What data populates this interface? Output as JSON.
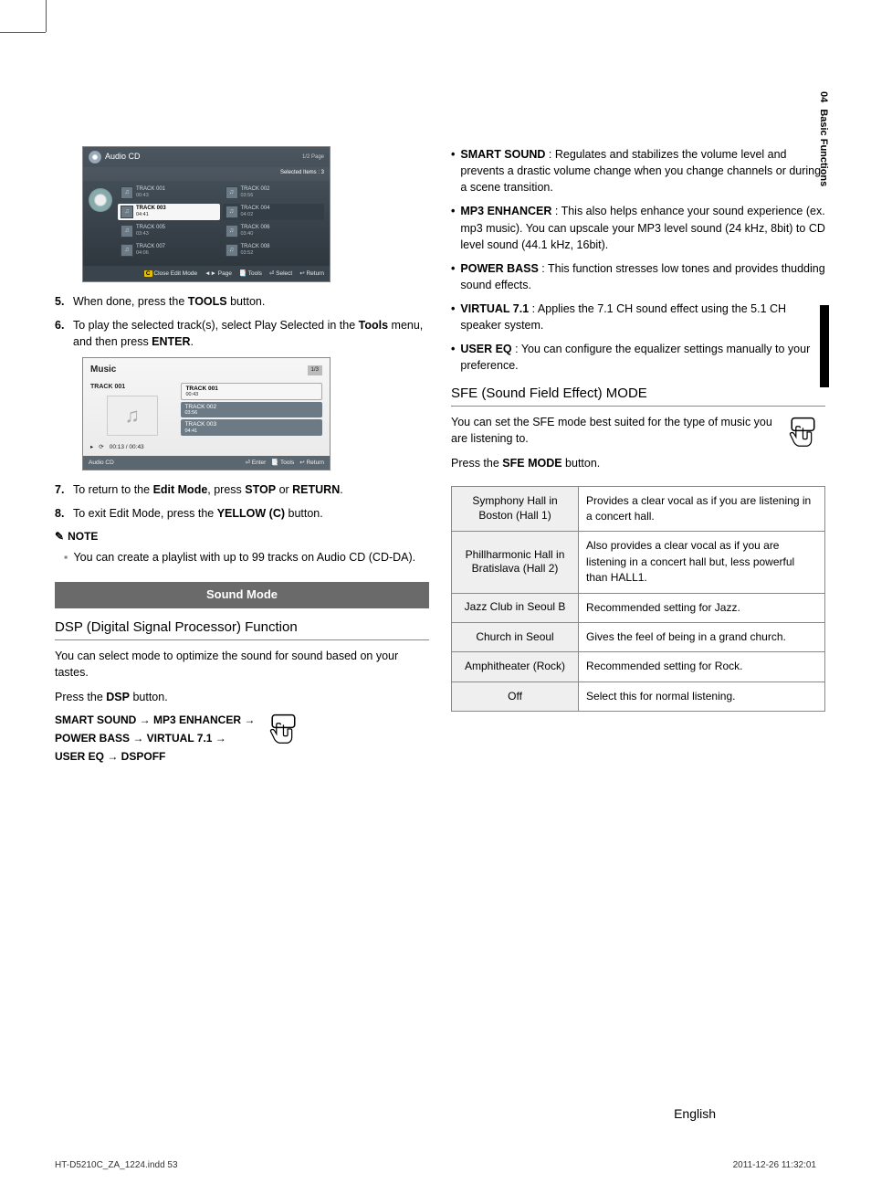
{
  "sideTab": {
    "num": "04",
    "label": "Basic Functions"
  },
  "shot1": {
    "title": "Audio CD",
    "page": "1/2 Page",
    "subtitle": "Selected Items : 3",
    "tracks": [
      {
        "t": "TRACK 001",
        "d": "00:43"
      },
      {
        "t": "TRACK 002",
        "d": "03:56"
      },
      {
        "t": "TRACK 003",
        "d": "04:41"
      },
      {
        "t": "TRACK 004",
        "d": "04:02"
      },
      {
        "t": "TRACK 005",
        "d": "03:43"
      },
      {
        "t": "TRACK 006",
        "d": "03:40"
      },
      {
        "t": "TRACK 007",
        "d": "04:06"
      },
      {
        "t": "TRACK 008",
        "d": "03:52"
      }
    ],
    "foot": {
      "c": "C",
      "close": "Close Edit Mode",
      "page": "◄► Page",
      "tools": "📑 Tools",
      "select": "⏎ Select",
      "return": "↩ Return"
    }
  },
  "steps1": [
    {
      "n": "5.",
      "before": "When done, press the ",
      "bold": "TOOLS",
      "after": " button."
    },
    {
      "n": "6.",
      "text": "To play the selected track(s), select Play Selected in the ",
      "bold": "Tools",
      "text2": " menu, and then press ",
      "bold2": "ENTER",
      "text3": "."
    }
  ],
  "shot2": {
    "title": "Music",
    "page": "1/3",
    "current": "TRACK 001",
    "progress": "00:13 / 00:43",
    "rows": [
      {
        "t": "TRACK 001",
        "d": "00:43"
      },
      {
        "t": "TRACK 002",
        "d": "03:56"
      },
      {
        "t": "TRACK 003",
        "d": "04:41"
      }
    ],
    "footLeft": "Audio CD",
    "foot": {
      "enter": "⏎ Enter",
      "tools": "📑 Tools",
      "return": "↩ Return"
    }
  },
  "steps2": [
    {
      "n": "7.",
      "before": "To return to the ",
      "b1": "Edit Mode",
      "mid": ", press ",
      "b2": "STOP",
      "mid2": " or ",
      "b3": "RETURN",
      "after": "."
    },
    {
      "n": "8.",
      "before": "To exit Edit Mode, press the ",
      "b1": "YELLOW (C)",
      "after": " button."
    }
  ],
  "noteHead": "NOTE",
  "noteItem": "You can create a playlist with up to 99 tracks on Audio CD (CD-DA).",
  "soundModeBanner": "Sound Mode",
  "dspTitle": "DSP (Digital Signal Processor) Function",
  "dspIntro": "You can select mode to optimize the sound for sound based on your tastes.",
  "dspPress": {
    "before": "Press the ",
    "bold": "DSP",
    "after": " button."
  },
  "dspFlow": {
    "l1": "SMART SOUND → MP3 ENHANCER →",
    "l2": "POWER BASS →  VIRTUAL 7.1 →",
    "l3": "USER EQ → DSPOFF"
  },
  "features": [
    {
      "bold": "SMART SOUND",
      "text": " : Regulates and stabilizes the volume level and prevents a drastic volume change when you change channels or during a scene transition."
    },
    {
      "bold": "MP3 ENHANCER",
      "text": " : This also helps enhance your sound experience (ex. mp3 music). You can upscale your MP3 level sound (24 kHz, 8bit) to CD level sound (44.1 kHz, 16bit)."
    },
    {
      "bold": "POWER BASS",
      "text": " : This function stresses low tones and provides thudding sound effects."
    },
    {
      "bold": "VIRTUAL 7.1",
      "text": " : Applies the 7.1 CH sound effect using the 5.1 CH speaker system."
    },
    {
      "bold": "USER EQ",
      "text": " : You can configure the equalizer settings manually to your preference."
    }
  ],
  "sfeTitle": "SFE (Sound Field Effect) MODE",
  "sfeIntro": "You can set the SFE mode best suited for the type of music you are listening to.",
  "sfePress": {
    "before": "Press the ",
    "bold": "SFE MODE",
    "after": " button."
  },
  "sfeTable": [
    {
      "l": "Symphony Hall in Boston (Hall 1)",
      "r": "Provides a clear vocal as if you are listening in a concert hall."
    },
    {
      "l": "Phillharmonic Hall in Bratislava (Hall 2)",
      "r": "Also provides a clear vocal as if you are listening in a concert hall but, less powerful than HALL1."
    },
    {
      "l": "Jazz Club in Seoul B",
      "r": "Recommended setting for Jazz."
    },
    {
      "l": "Church in Seoul",
      "r": "Gives the feel of being in a grand church."
    },
    {
      "l": "Amphitheater (Rock)",
      "r": "Recommended setting for Rock."
    },
    {
      "l": "Off",
      "r": "Select this for normal listening."
    }
  ],
  "lang": "English",
  "footer": {
    "left": "HT-D5210C_ZA_1224.indd   53",
    "right": "2011-12-26     11:32:01"
  }
}
